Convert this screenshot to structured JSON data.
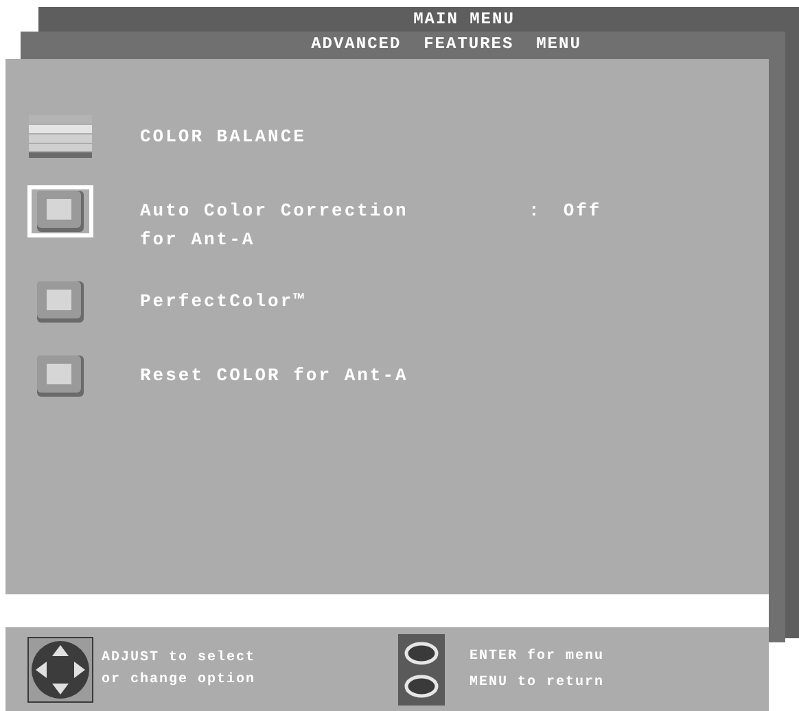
{
  "main_menu": {
    "title": "MAIN MENU"
  },
  "submenu": {
    "title": "ADVANCED  FEATURES  MENU"
  },
  "items": [
    {
      "kind": "bars",
      "label": "COLOR BALANCE",
      "selected": false
    },
    {
      "kind": "button",
      "label": "Auto Color Correction\nfor Ant-A",
      "separator": ":",
      "value": "Off",
      "selected": true
    },
    {
      "kind": "button",
      "label": "PerfectColor™",
      "selected": false
    },
    {
      "kind": "button",
      "label": "Reset COLOR for Ant-A",
      "selected": false
    }
  ],
  "help": [
    {
      "kind": "dpad",
      "text": "ADJUST to select\nor change option"
    },
    {
      "kind": "keys",
      "lines": [
        "ENTER for menu",
        "MENU to return"
      ]
    }
  ]
}
